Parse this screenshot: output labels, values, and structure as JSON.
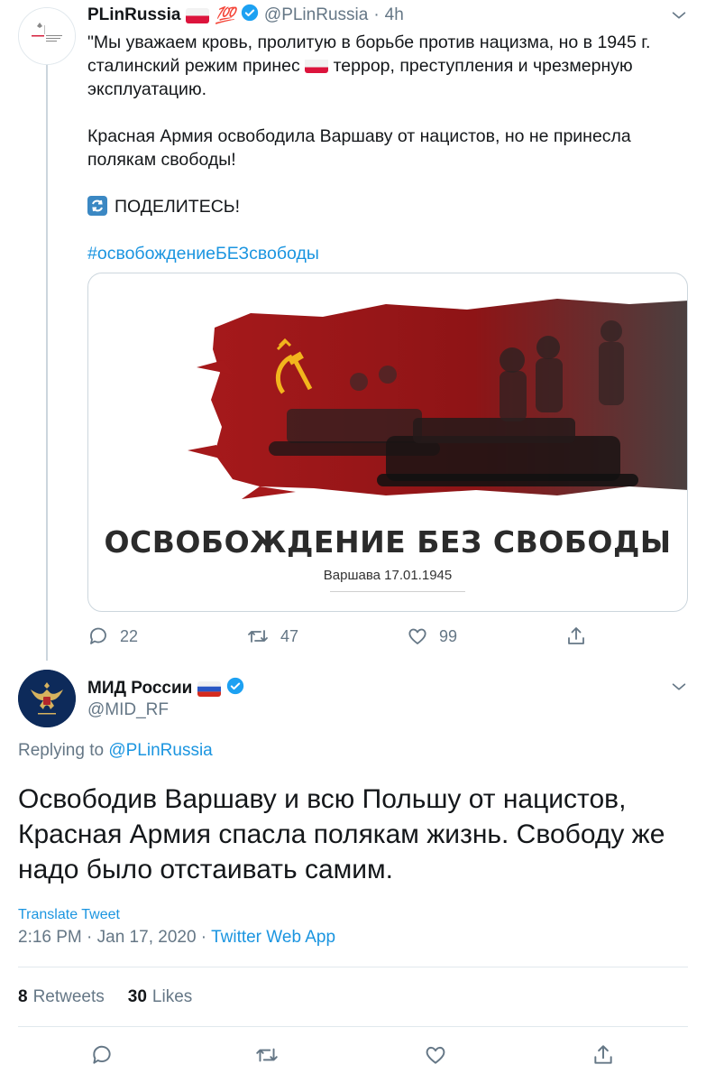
{
  "tweet1": {
    "display_name": "PLinRussia",
    "name_emoji": "💯",
    "handle": "@PLinRussia",
    "separator": "·",
    "time_ago": "4h",
    "avatar_caption": "Посольство Республики Польша в Москве",
    "text_p1_a": "\"Мы уважаем кровь, пролитую в борьбе против нацизма, но в 1945 г. сталинский режим принес",
    "text_p1_b": "террор, преступления и чрезмерную эксплуатацию.",
    "text_p2": "Красная Армия освободила Варшаву от нацистов, но не принесла полякам свободы!",
    "text_share": "ПОДЕЛИТЕСЬ!",
    "hashtag": "#освобождениеБЕЗсвободы",
    "card": {
      "title": "ОСВОБОЖДЕНИЕ БЕЗ СВОБОДЫ",
      "subtitle": "Варшава 17.01.1945"
    },
    "replies": "22",
    "retweets": "47",
    "likes": "99"
  },
  "tweet2": {
    "display_name": "МИД России",
    "handle": "@MID_RF",
    "replying_prefix": "Replying to",
    "replying_to": "@PLinRussia",
    "text": "Освободив Варшаву и всю Польшу от нацистов, Красная Армия спасла полякам жизнь. Свободу же надо было отстаивать самим.",
    "translate_label": "Translate Tweet",
    "timestamp": "2:16 PM · Jan 17, 2020 ·",
    "source": "Twitter Web App",
    "retweet_count": "8",
    "retweet_label": "Retweets",
    "like_count": "30",
    "like_label": "Likes"
  },
  "colors": {
    "verified": "#1da1f2",
    "link": "#1b95e0",
    "muted": "#657786",
    "banner_red": "#a5191b"
  }
}
